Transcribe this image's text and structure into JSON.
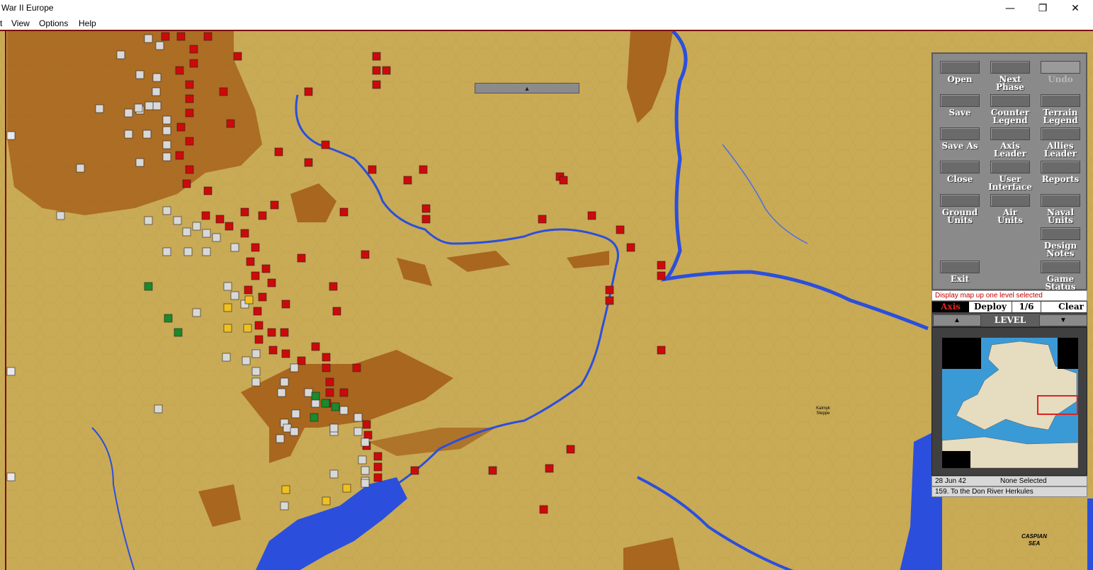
{
  "window": {
    "title": "War II Europe",
    "minimize_glyph": "—",
    "maximize_glyph": "❐",
    "close_glyph": "✕"
  },
  "menu": {
    "items": [
      "View",
      "Options",
      "Help"
    ],
    "partial_left": "t"
  },
  "map": {
    "scroll_up_glyph": "▲",
    "labels": {
      "caspian_sea_1": "CASPIAN",
      "caspian_sea_2": "SEA",
      "kalmyk_1": "Kalmyk",
      "kalmyk_2": "Steppe"
    },
    "colors": {
      "land": "#c9aa55",
      "hills": "#a8661f",
      "water": "#2b4fdc",
      "axis_unit": "#d8d8d8",
      "soviet_unit": "#cc0a0a",
      "hungarian_unit": "#f0c020",
      "romanian_unit": "#1a8a2a"
    }
  },
  "panel": {
    "buttons": [
      {
        "label1": "Open",
        "label2": "",
        "enabled": true
      },
      {
        "label1": "Next",
        "label2": "Phase",
        "enabled": true
      },
      {
        "label1": "Undo",
        "label2": "",
        "enabled": false
      },
      {
        "label1": "Save",
        "label2": "",
        "enabled": true
      },
      {
        "label1": "Counter",
        "label2": "Legend",
        "enabled": true
      },
      {
        "label1": "Terrain",
        "label2": "Legend",
        "enabled": true
      },
      {
        "label1": "Save As",
        "label2": "",
        "enabled": true
      },
      {
        "label1": "Axis",
        "label2": "Leader",
        "enabled": true
      },
      {
        "label1": "Allies",
        "label2": "Leader",
        "enabled": true
      },
      {
        "label1": "Close",
        "label2": "",
        "enabled": true
      },
      {
        "label1": "User",
        "label2": "Interface",
        "enabled": true
      },
      {
        "label1": "Reports",
        "label2": "",
        "enabled": true
      },
      {
        "label1": "Ground",
        "label2": "Units",
        "enabled": true
      },
      {
        "label1": "Air",
        "label2": "Units",
        "enabled": true
      },
      {
        "label1": "Naval",
        "label2": "Units",
        "enabled": true
      },
      {
        "label1": "Design",
        "label2": "Notes",
        "enabled": true
      },
      {
        "label1": "Exit",
        "label2": "",
        "enabled": true
      },
      {
        "label1": "Game",
        "label2": "Status",
        "enabled": true
      }
    ],
    "status_message": "Display map up one level selected",
    "phase": {
      "side": "Axis",
      "name": "Deploy",
      "count": "1/6",
      "clear": "Clear"
    },
    "level": {
      "label": "LEVEL",
      "up_glyph": "▲",
      "down_glyph": "▼"
    },
    "info": {
      "date": "28 Jun 42",
      "selection": "None Selected",
      "scenario": "159. To the Don River Herkules"
    }
  }
}
